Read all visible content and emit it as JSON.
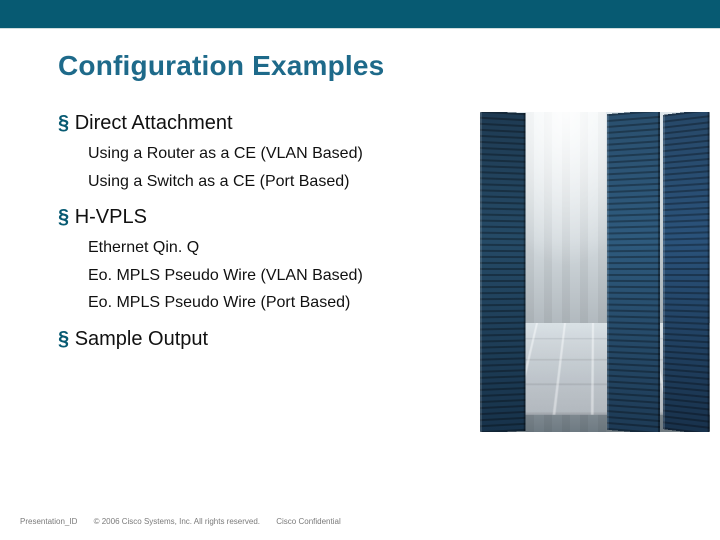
{
  "title": "Configuration Examples",
  "sections": [
    {
      "heading": "Direct Attachment",
      "subs": [
        "Using a Router as a CE (VLAN Based)",
        "Using a Switch as a CE (Port Based)"
      ]
    },
    {
      "heading": "H-VPLS",
      "subs": [
        "Ethernet Qin. Q",
        "Eo. MPLS Pseudo Wire (VLAN Based)",
        "Eo. MPLS Pseudo Wire (Port Based)"
      ]
    },
    {
      "heading": "Sample Output",
      "subs": []
    }
  ],
  "footer": {
    "presentation_id": "Presentation_ID",
    "copyright": "© 2006 Cisco Systems, Inc. All rights reserved.",
    "confidential": "Cisco Confidential"
  }
}
